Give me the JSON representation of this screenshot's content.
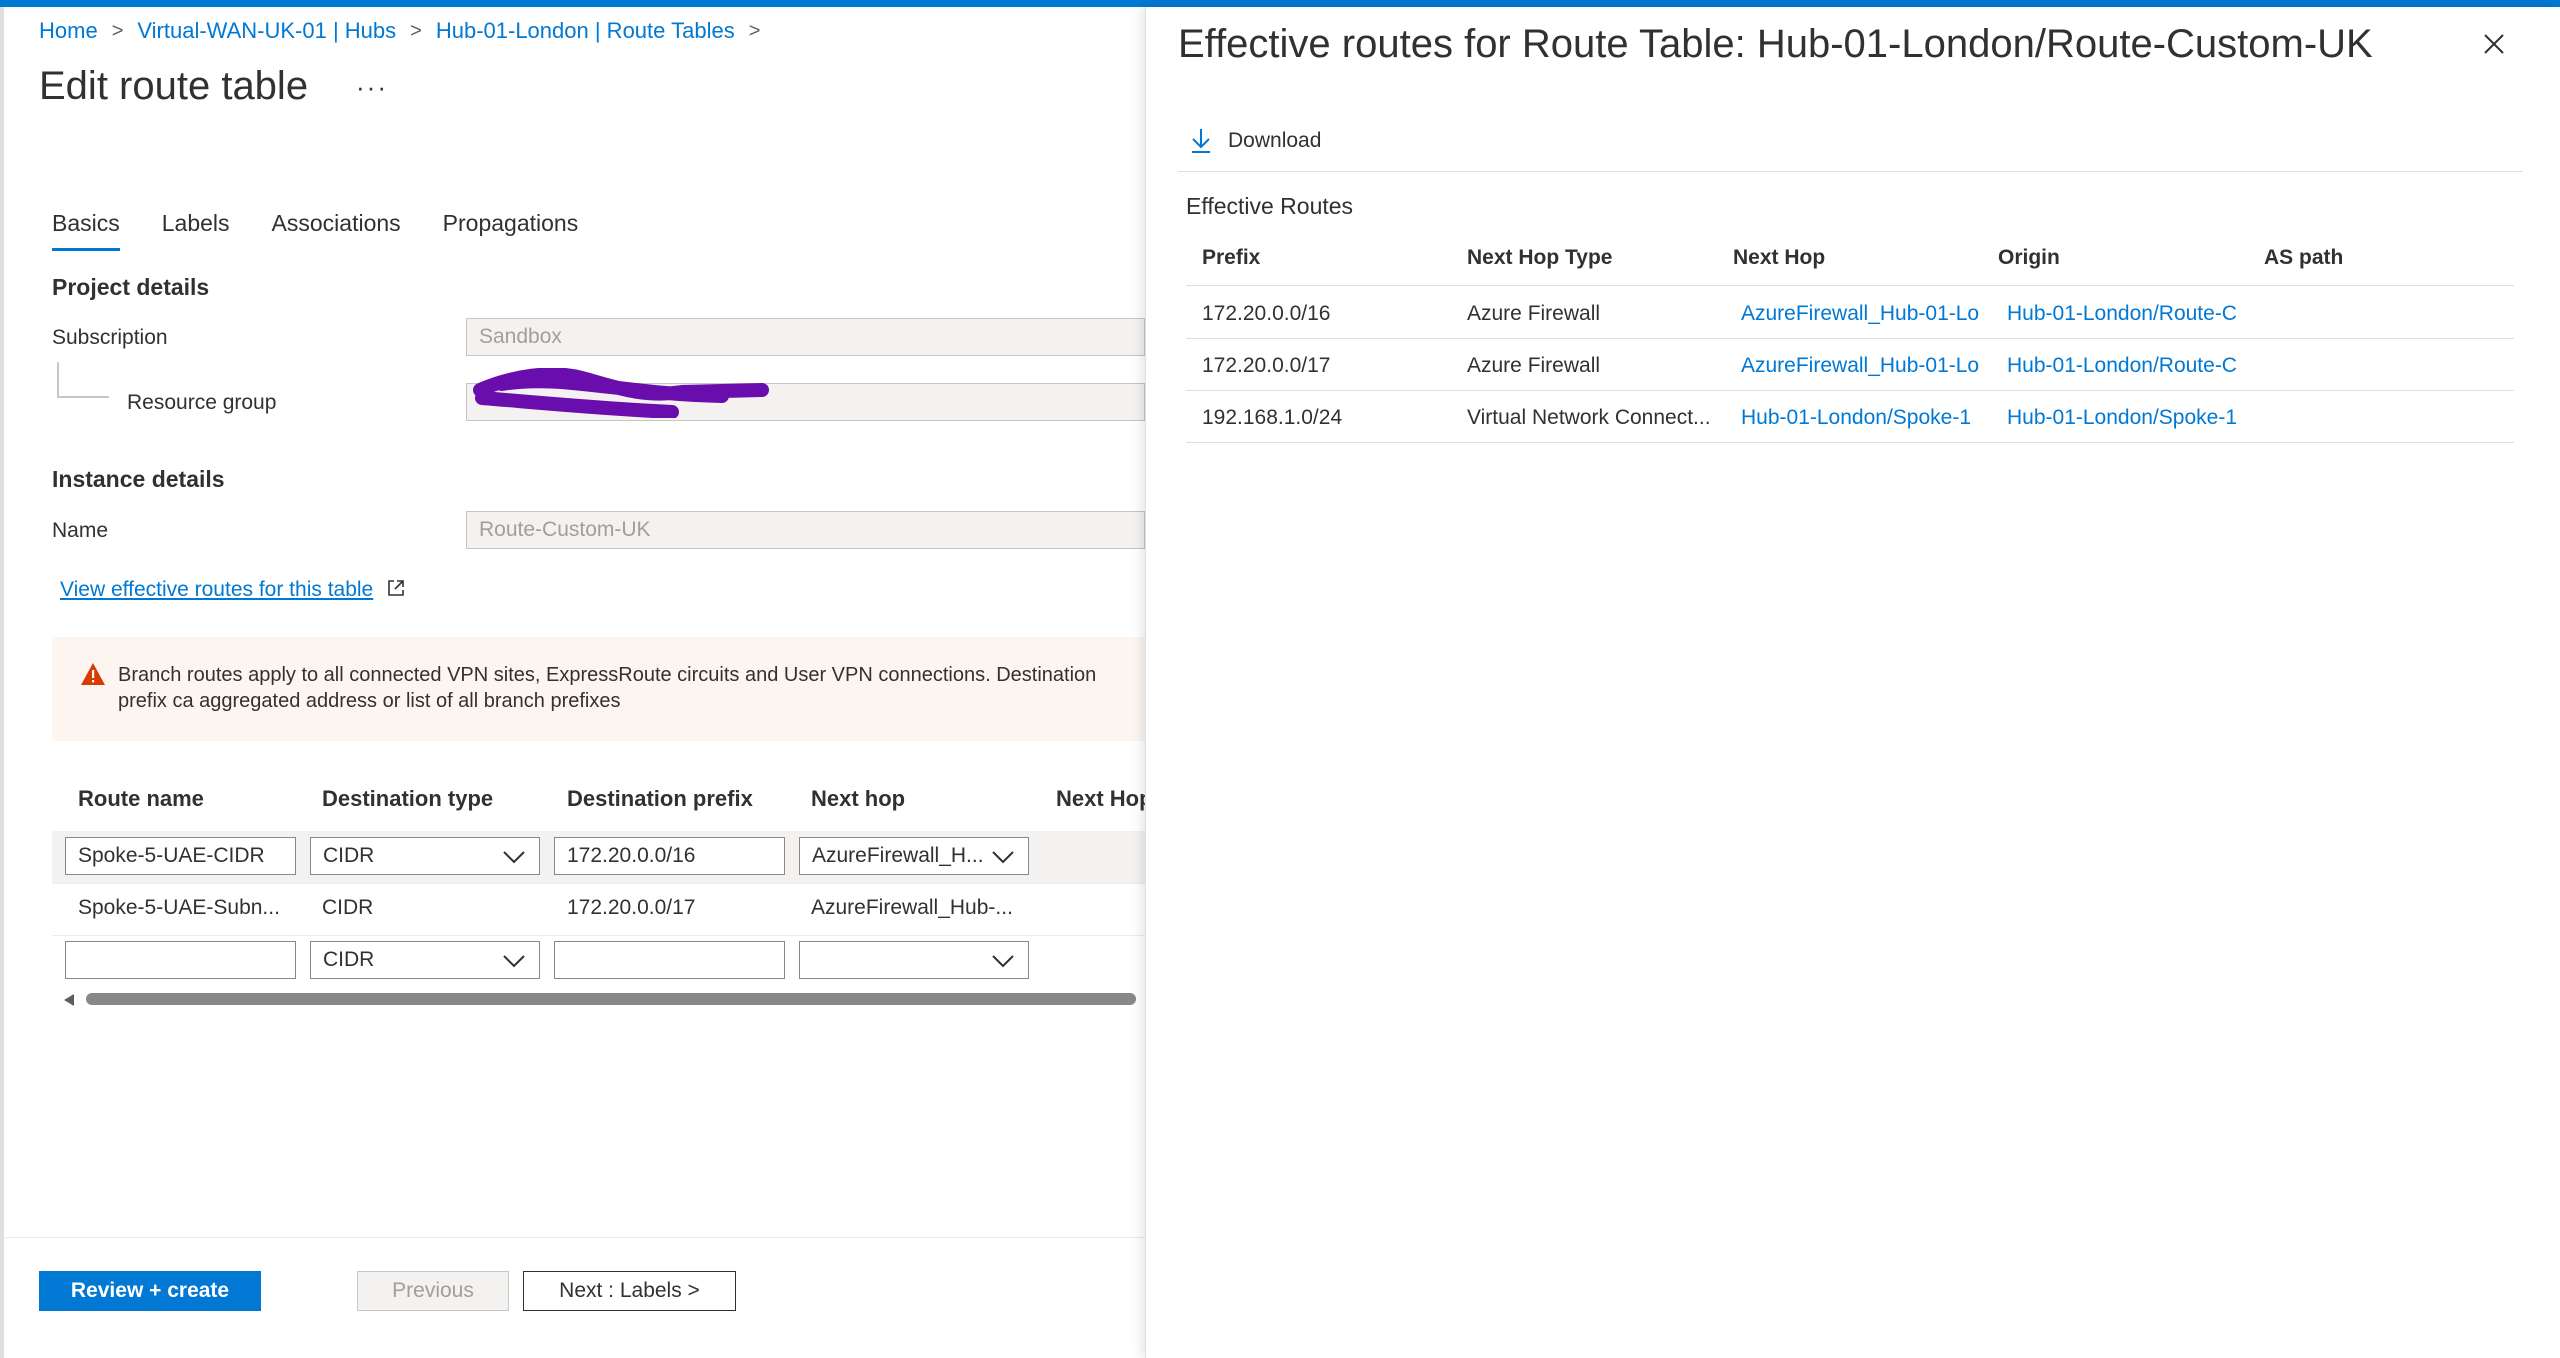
{
  "breadcrumb": {
    "items": [
      {
        "label": "Home"
      },
      {
        "label": "Virtual-WAN-UK-01 | Hubs"
      },
      {
        "label": "Hub-01-London | Route Tables"
      }
    ],
    "separator": ">"
  },
  "page": {
    "title": "Edit route table",
    "more": "···"
  },
  "tabs": [
    {
      "label": "Basics",
      "active": true
    },
    {
      "label": "Labels",
      "active": false
    },
    {
      "label": "Associations",
      "active": false
    },
    {
      "label": "Propagations",
      "active": false
    }
  ],
  "project_details": {
    "heading": "Project details",
    "subscription_label": "Subscription",
    "subscription_value": "Sandbox",
    "resource_group_label": "Resource group"
  },
  "instance_details": {
    "heading": "Instance details",
    "name_label": "Name",
    "name_value": "Route-Custom-UK"
  },
  "effective_routes_link": "View effective routes for this table",
  "warning": {
    "text": "Branch routes apply to all connected VPN sites, ExpressRoute circuits and User VPN connections. Destination prefix ca aggregated address or list of all branch prefixes"
  },
  "routes_table": {
    "headers": [
      "Route name",
      "Destination type",
      "Destination prefix",
      "Next hop",
      "Next Hop"
    ],
    "rows": [
      {
        "name": "Spoke-5-UAE-CIDR",
        "dest_type": "CIDR",
        "prefix": "172.20.0.0/16",
        "next_hop": "AzureFirewall_H..."
      },
      {
        "name": "Spoke-5-UAE-Subn...",
        "dest_type": "CIDR",
        "prefix": "172.20.0.0/17",
        "next_hop": "AzureFirewall_Hub-..."
      },
      {
        "name": "",
        "dest_type": "CIDR",
        "prefix": "",
        "next_hop": ""
      }
    ]
  },
  "footer": {
    "review_create": "Review + create",
    "previous": "Previous",
    "next": "Next : Labels >"
  },
  "panel": {
    "title": "Effective routes for Route Table: Hub-01-London/Route-Custom-UK",
    "download": "Download",
    "section_label": "Effective Routes",
    "headers": [
      "Prefix",
      "Next Hop Type",
      "Next Hop",
      "Origin",
      "AS path"
    ],
    "rows": [
      {
        "prefix": "172.20.0.0/16",
        "next_hop_type": "Azure Firewall",
        "next_hop": "AzureFirewall_Hub-01-Lo",
        "origin": "Hub-01-London/Route-C",
        "as_path": ""
      },
      {
        "prefix": "172.20.0.0/17",
        "next_hop_type": "Azure Firewall",
        "next_hop": "AzureFirewall_Hub-01-Lo",
        "origin": "Hub-01-London/Route-C",
        "as_path": ""
      },
      {
        "prefix": "192.168.1.0/24",
        "next_hop_type": "Virtual Network Connect...",
        "next_hop": "Hub-01-London/Spoke-1",
        "origin": "Hub-01-London/Spoke-1",
        "as_path": ""
      }
    ]
  },
  "colors": {
    "accent": "#0078d4",
    "text": "#323130",
    "warning_icon": "#d83b01",
    "redaction": "#6a0dad"
  },
  "icons": {
    "breadcrumb_separator": "chevron-right-icon",
    "close": "close-icon",
    "download": "download-icon",
    "warning": "warning-icon",
    "external_link": "external-link-icon",
    "dropdown": "chevron-down-icon"
  }
}
